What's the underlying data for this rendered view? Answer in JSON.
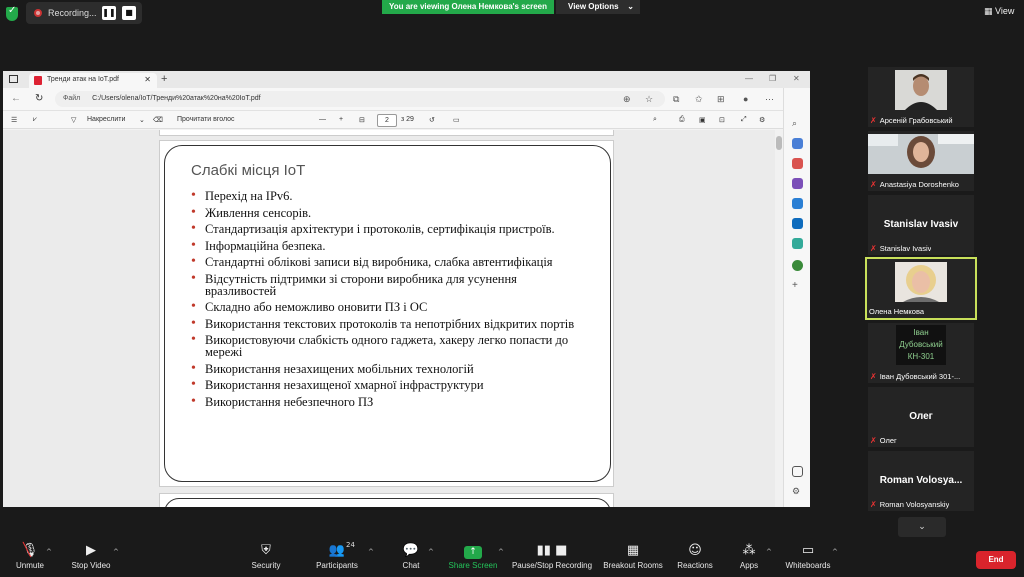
{
  "zoom_top": {
    "recording_label": "Recording...",
    "viewing_banner": "You are viewing Олена Немкова's screen",
    "view_options": "View Options",
    "view_button": "View"
  },
  "browser": {
    "tab_title": "Тренди атак на IoT.pdf",
    "url_label": "Файл",
    "url": "C:/Users/olena/IoT/Тренди%20атак%20на%20IoT.pdf",
    "pdf_toolbar": {
      "draw_label": "Накреслити",
      "read_aloud": "Прочитати вголос",
      "current_page": "2",
      "page_count": "з 29"
    }
  },
  "slide": {
    "title": "Слабкі місця IoT",
    "bullets": [
      "Перехід на IPv6.",
      "Живлення  сенсорів.",
      "Стандартизація архітектури і протоколів, сертифікація пристроїв.",
      "Інформаційна безпека.",
      "Стандартні облікові записи від виробника, слабка автентифікація",
      "Відсутність підтримки зі сторони виробника для усунення вразливостей",
      "Складно або неможливо оновити ПЗ і ОС",
      "Використання текстових протоколів та непотрібних відкритих портів",
      "Використовуючи слабкість одного гаджета, хакеру легко попасти до мережі",
      "Використання незахищених мобільних технологій",
      "Використання незахищеної хмарної інфраструктури",
      "Використання небезпечного ПЗ"
    ]
  },
  "participants": [
    {
      "label": "Арсеній Грабовський",
      "muted": true
    },
    {
      "label": "Anastasiya Doroshenko",
      "muted": true
    },
    {
      "big_name": "Stanislav Ivasiv",
      "label": "Stanislav Ivasiv",
      "muted": true
    },
    {
      "label": "Олена Немкова",
      "muted": false,
      "active": true
    },
    {
      "big_name_line1": "Іван",
      "big_name_line2": "Дубовський",
      "big_name_line3": "КН-301",
      "label": "Іван Дубовський 301-...",
      "muted": true
    },
    {
      "big_name": "Олег",
      "label": "Олег",
      "muted": true
    },
    {
      "big_name": "Roman Volosya...",
      "label": "Roman Volosyanskiy",
      "muted": true
    }
  ],
  "toolbar": {
    "unmute": "Unmute",
    "stop_video": "Stop Video",
    "security": "Security",
    "participants": "Participants",
    "participants_count": "24",
    "chat": "Chat",
    "share_screen": "Share Screen",
    "pause_recording": "Pause/Stop Recording",
    "breakout_rooms": "Breakout Rooms",
    "reactions": "Reactions",
    "apps": "Apps",
    "whiteboards": "Whiteboards",
    "end": "End"
  },
  "colors": {
    "zoom_green": "#23a94a",
    "end_red": "#d9242c",
    "active_speaker": "#c8e05a",
    "bullet_red": "#c0392b"
  }
}
